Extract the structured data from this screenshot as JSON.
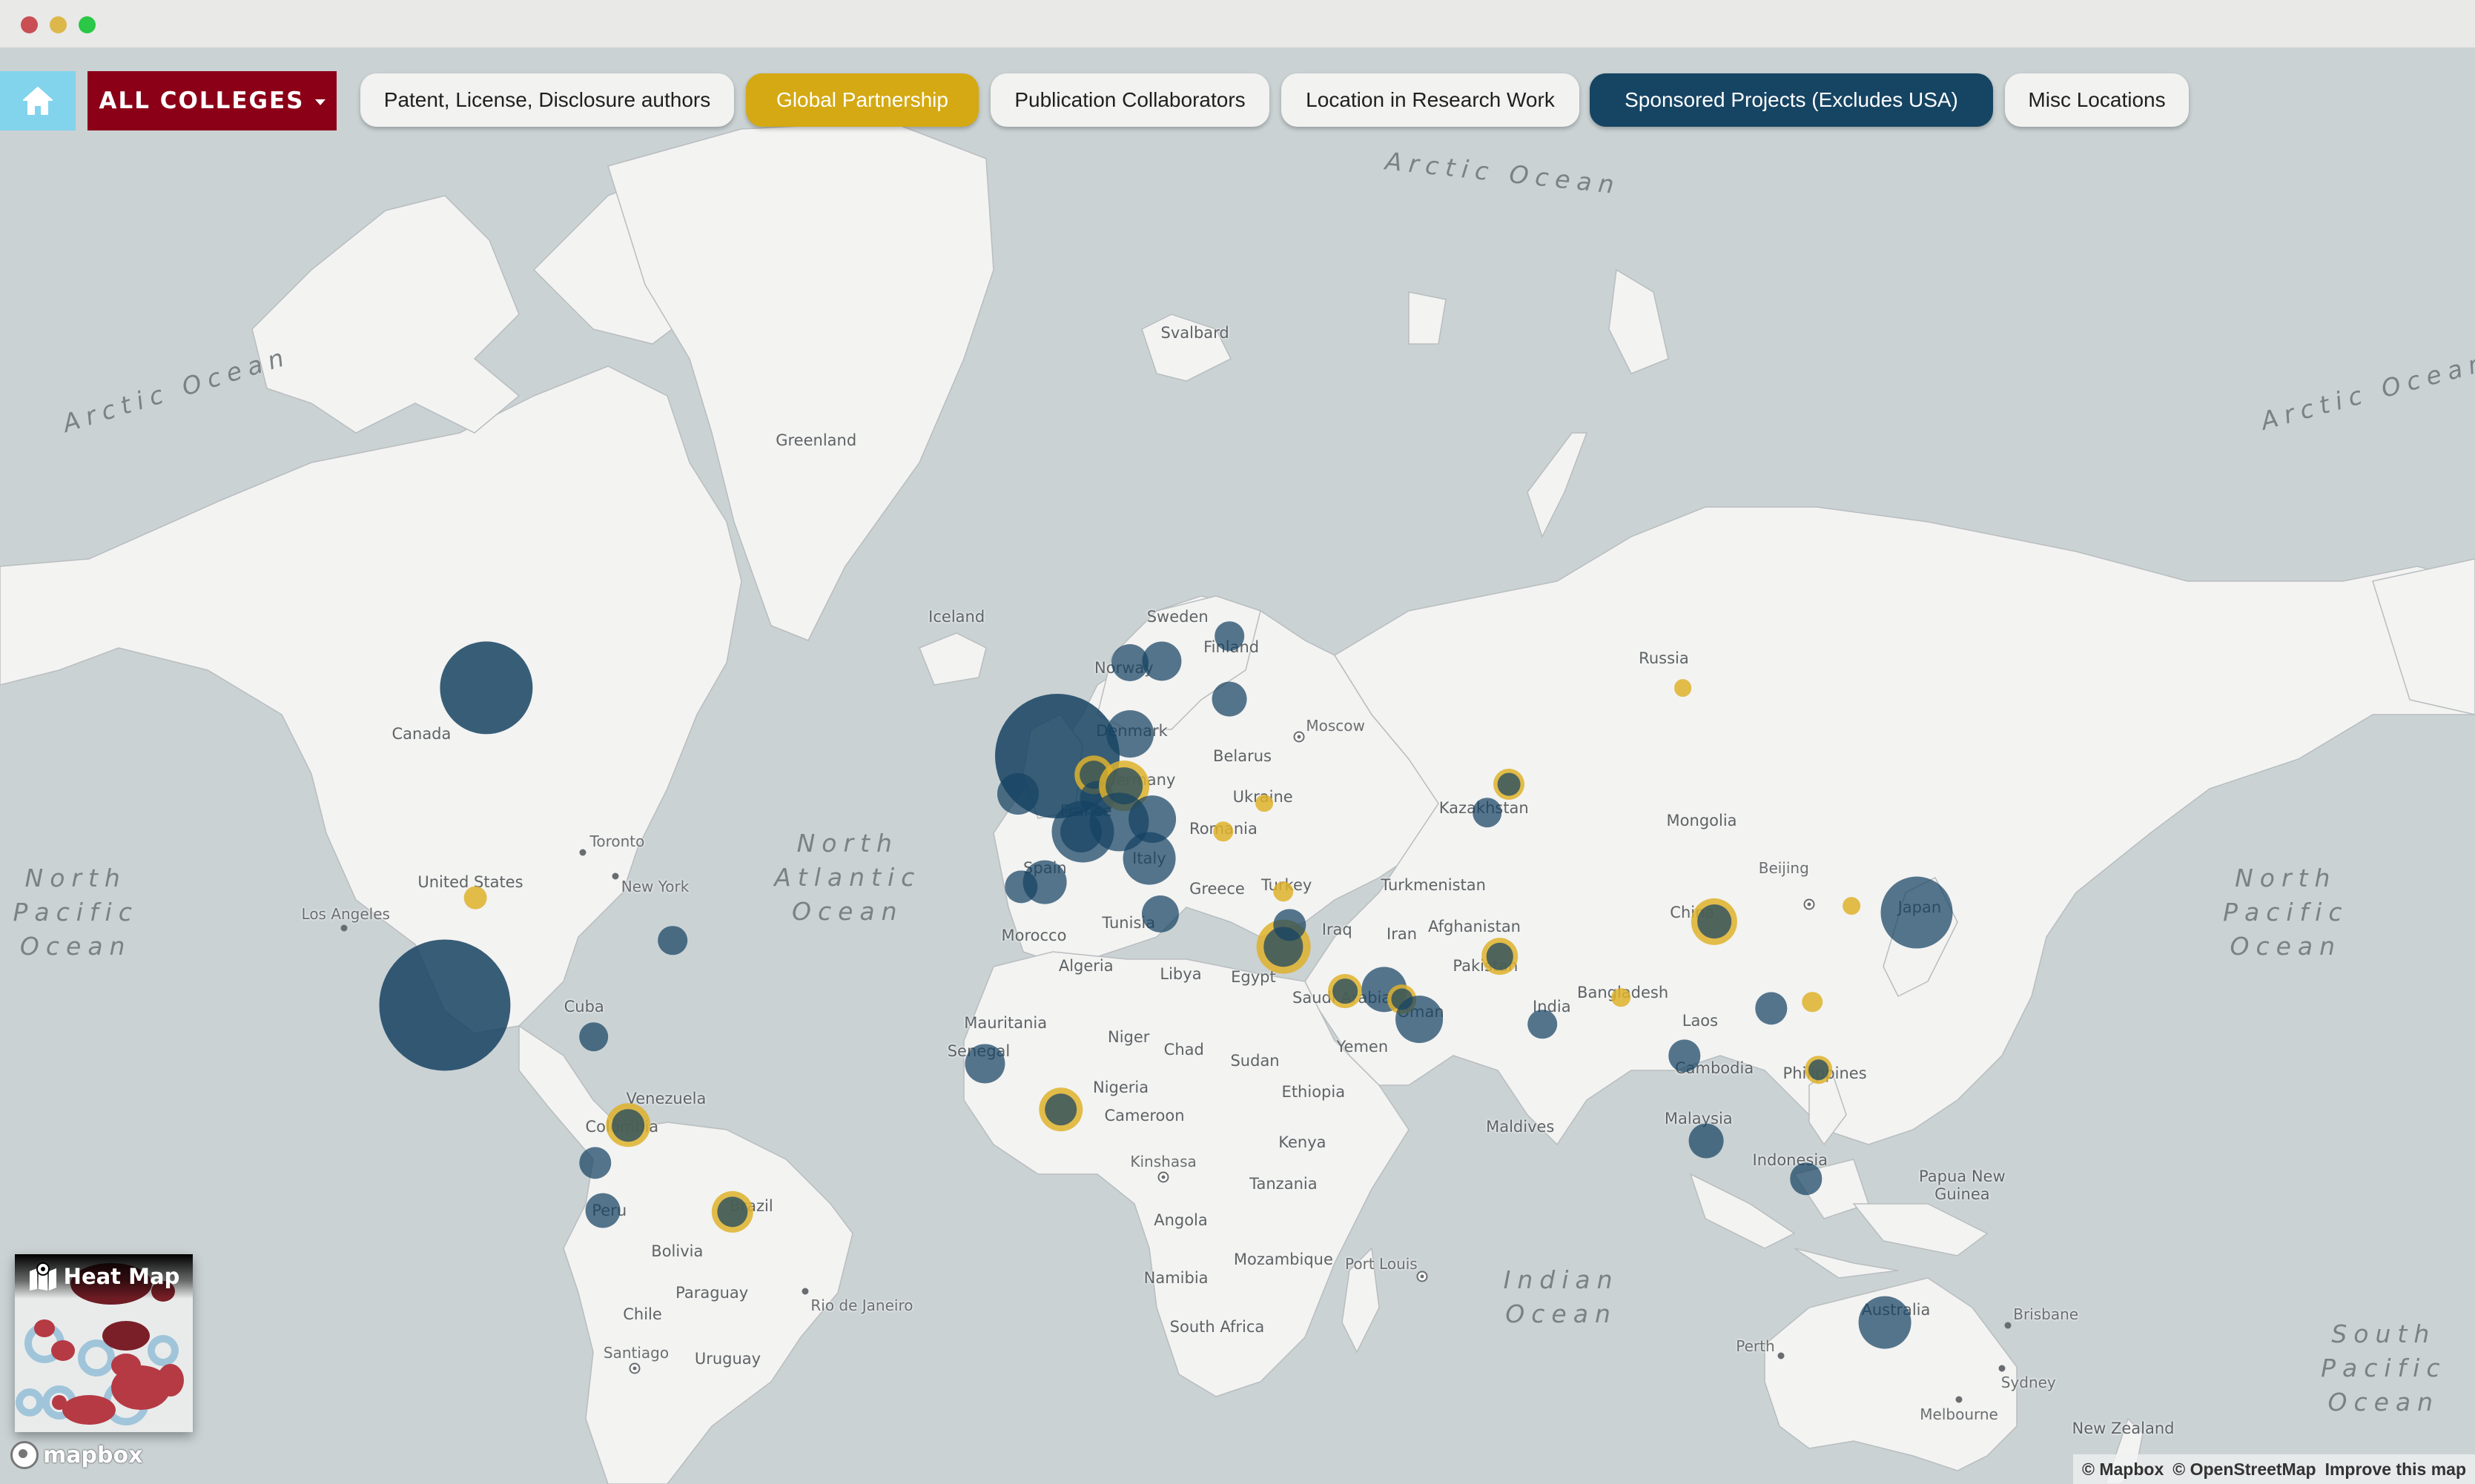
{
  "window": {
    "controls": [
      "close",
      "minimize",
      "maximize"
    ]
  },
  "toolbar": {
    "home_icon": "home-icon",
    "college_selector": {
      "label": "ALL COLLEGES",
      "icon": "caret-down-icon"
    },
    "layers": [
      {
        "label": "Patent, License, Disclosure authors",
        "state": "inactive"
      },
      {
        "label": "Global Partnership",
        "state": "active",
        "color": "#d4a913"
      },
      {
        "label": "Publication Collaborators",
        "state": "inactive"
      },
      {
        "label": "Location in Research Work",
        "state": "inactive"
      },
      {
        "label": "Sponsored Projects (Excludes USA)",
        "state": "active",
        "color": "#164463"
      },
      {
        "label": "Misc Locations",
        "state": "inactive"
      }
    ]
  },
  "colors": {
    "home": "#82d3ec",
    "college": "#8b0017",
    "global_partnership": "#d4a913",
    "sponsored_projects": "#164463",
    "water": "#cad2d4",
    "land": "#f3f3f2"
  },
  "map": {
    "oceans": [
      {
        "name": "Arctic Ocean"
      },
      {
        "name": "Arctic Ocean"
      },
      {
        "name": "Arctic Ocean"
      },
      {
        "name": "North Pacific Ocean"
      },
      {
        "name": "North Atlantic Ocean"
      },
      {
        "name": "North Pacific Ocean"
      },
      {
        "name": "Indian Ocean"
      },
      {
        "name": "South Pacific Ocean"
      },
      {
        "name": "South Pacific Ocean"
      }
    ],
    "labels": [
      "Greenland",
      "Svalbard",
      "Iceland",
      "Canada",
      "United States",
      "Toronto",
      "New York",
      "Los Angeles",
      "Cuba",
      "Venezuela",
      "Colombia",
      "Peru",
      "Brazil",
      "Bolivia",
      "Paraguay",
      "Chile",
      "Santiago",
      "Uruguay",
      "Rio de Janeiro",
      "Sweden",
      "Finland",
      "Norway",
      "Denmark",
      "Belarus",
      "Moscow",
      "Ukraine",
      "Romania",
      "Germany",
      "France",
      "Spain",
      "Italy",
      "Greece",
      "Turkey",
      "Tunisia",
      "Morocco",
      "Algeria",
      "Libya",
      "Egypt",
      "Mauritania",
      "Senegal",
      "Niger",
      "Chad",
      "Sudan",
      "Nigeria",
      "Cameroon",
      "Ethiopia",
      "Kenya",
      "Kinshasa",
      "Tanzania",
      "Angola",
      "Mozambique",
      "Namibia",
      "South Africa",
      "Port Louis",
      "Iraq",
      "Iran",
      "Saudi Arabia",
      "Yemen",
      "Oman",
      "Turkmenistan",
      "Afghanistan",
      "Pakistan",
      "India",
      "Kazakhstan",
      "Russia",
      "Mongolia",
      "Beijing",
      "China",
      "Japan",
      "Bangladesh",
      "Laos",
      "Cambodia",
      "Philippines",
      "Malaysia",
      "Indonesia",
      "Papua New Guinea",
      "Maldives",
      "Australia",
      "Brisbane",
      "Perth",
      "Sydney",
      "Melbourne",
      "New Zealand"
    ],
    "markers": [
      {
        "country": "Canada",
        "layer": "sponsored",
        "relative_size": 5
      },
      {
        "country": "Mexico",
        "layer": "sponsored",
        "relative_size": 10
      },
      {
        "country": "United States",
        "layer": "partnership",
        "relative_size": 1
      },
      {
        "country": "Bermuda",
        "layer": "sponsored",
        "relative_size": 0.5
      },
      {
        "country": "Haiti",
        "layer": "sponsored",
        "relative_size": 0.5
      },
      {
        "country": "Colombia",
        "layer": "both",
        "relative_size": 2
      },
      {
        "country": "Ecuador",
        "layer": "sponsored",
        "relative_size": 0.6
      },
      {
        "country": "Peru",
        "layer": "sponsored",
        "relative_size": 0.7
      },
      {
        "country": "Brazil",
        "layer": "both",
        "relative_size": 1.8
      },
      {
        "country": "United Kingdom",
        "layer": "sponsored",
        "relative_size": 9
      },
      {
        "country": "Ireland",
        "layer": "sponsored",
        "relative_size": 1
      },
      {
        "country": "Norway",
        "layer": "sponsored",
        "relative_size": 0.8
      },
      {
        "country": "Sweden",
        "layer": "sponsored",
        "relative_size": 0.9
      },
      {
        "country": "Finland",
        "layer": "sponsored",
        "relative_size": 0.5
      },
      {
        "country": "Estonia",
        "layer": "sponsored",
        "relative_size": 0.7
      },
      {
        "country": "Denmark",
        "layer": "sponsored",
        "relative_size": 1.3
      },
      {
        "country": "Netherlands",
        "layer": "both",
        "relative_size": 1.5
      },
      {
        "country": "Belgium",
        "layer": "sponsored",
        "relative_size": 1
      },
      {
        "country": "Luxembourg",
        "layer": "sponsored",
        "relative_size": 0.7
      },
      {
        "country": "Germany",
        "layer": "both",
        "relative_size": 2.6
      },
      {
        "country": "France",
        "layer": "sponsored",
        "relative_size": 2.2
      },
      {
        "country": "Switzerland",
        "layer": "sponsored",
        "relative_size": 2
      },
      {
        "country": "Austria",
        "layer": "sponsored",
        "relative_size": 1.3
      },
      {
        "country": "Italy",
        "layer": "sponsored",
        "relative_size": 1.6
      },
      {
        "country": "Spain",
        "layer": "sponsored",
        "relative_size": 1.1
      },
      {
        "country": "Portugal",
        "layer": "sponsored",
        "relative_size": 0.6
      },
      {
        "country": "Ukraine",
        "layer": "partnership",
        "relative_size": 0.6
      },
      {
        "country": "Romania",
        "layer": "partnership",
        "relative_size": 0.8
      },
      {
        "country": "Turkey",
        "layer": "partnership",
        "relative_size": 0.8
      },
      {
        "country": "Tunisia",
        "layer": "sponsored",
        "relative_size": 0.8
      },
      {
        "country": "Senegal",
        "layer": "sponsored",
        "relative_size": 0.9
      },
      {
        "country": "Ghana",
        "layer": "both",
        "relative_size": 2
      },
      {
        "country": "Egypt / Israel / Jordan",
        "layer": "both",
        "relative_size": 3
      },
      {
        "country": "Lebanon",
        "layer": "sponsored",
        "relative_size": 0.6
      },
      {
        "country": "Saudi Arabia",
        "layer": "both",
        "relative_size": 1.2
      },
      {
        "country": "Qatar",
        "layer": "sponsored",
        "relative_size": 1.2
      },
      {
        "country": "United Arab Emirates",
        "layer": "both",
        "relative_size": 0.9
      },
      {
        "country": "Oman",
        "layer": "sponsored",
        "relative_size": 1.3
      },
      {
        "country": "Pakistan",
        "layer": "both",
        "relative_size": 1.4
      },
      {
        "country": "India",
        "layer": "sponsored",
        "relative_size": 0.5
      },
      {
        "country": "Kazakhstan",
        "layer": "both",
        "relative_size": 1
      },
      {
        "country": "Kazakhstan (south)",
        "layer": "sponsored",
        "relative_size": 0.5
      },
      {
        "country": "Russia",
        "layer": "partnership",
        "relative_size": 0.6
      },
      {
        "country": "China",
        "layer": "both",
        "relative_size": 2.2
      },
      {
        "country": "South Korea",
        "layer": "partnership",
        "relative_size": 0.6
      },
      {
        "country": "Japan",
        "layer": "sponsored",
        "relative_size": 3
      },
      {
        "country": "Bangladesh",
        "layer": "partnership",
        "relative_size": 0.7
      },
      {
        "country": "Hong Kong",
        "layer": "sponsored",
        "relative_size": 0.6
      },
      {
        "country": "Taiwan",
        "layer": "partnership",
        "relative_size": 0.8
      },
      {
        "country": "Thailand",
        "layer": "sponsored",
        "relative_size": 0.6
      },
      {
        "country": "Philippines",
        "layer": "both",
        "relative_size": 0.8
      },
      {
        "country": "Malaysia",
        "layer": "sponsored",
        "relative_size": 0.7
      },
      {
        "country": "Indonesia",
        "layer": "sponsored",
        "relative_size": 0.6
      },
      {
        "country": "Australia",
        "layer": "sponsored",
        "relative_size": 1.6
      }
    ]
  },
  "heatmap_toggle": {
    "label": "Heat Map",
    "icon": "map-pin-icon"
  },
  "mapbox_logo": "mapbox",
  "attribution": {
    "mapbox": "© Mapbox",
    "osm": "© OpenStreetMap",
    "improve": "Improve this map"
  }
}
